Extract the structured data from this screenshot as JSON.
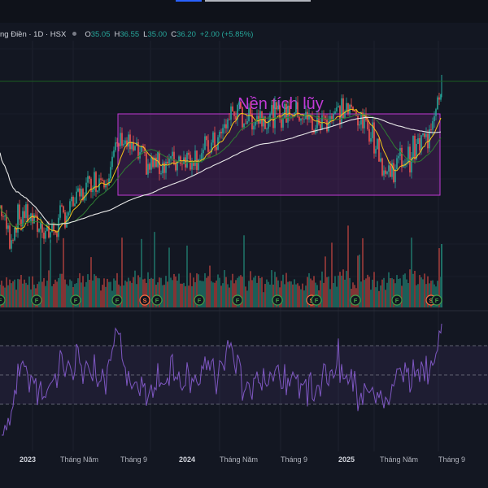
{
  "symbol": {
    "title": "ng Điền · 1D · HSX",
    "open_label": "O",
    "open": "35.05",
    "high_label": "H",
    "high": "36.55",
    "low_label": "L",
    "low": "35.00",
    "close_label": "C",
    "close": "36.20",
    "change": "+2.00 (+5.85%)"
  },
  "annotation": {
    "text": "Nền tích lũy"
  },
  "colors": {
    "up": "#26a69a",
    "down": "#ef5350",
    "box": "#9c27b0",
    "rsi": "#7e57c2",
    "ma_yellow": "#f5c518",
    "ma_white": "#e8e8e8",
    "ma_green": "#2e7d32"
  },
  "x_axis_labels": [
    {
      "text": "2023",
      "year": true
    },
    {
      "text": "Tháng Năm",
      "year": false
    },
    {
      "text": "Tháng 9",
      "year": false
    },
    {
      "text": "2024",
      "year": true
    },
    {
      "text": "Tháng Năm",
      "year": false
    },
    {
      "text": "Tháng 9",
      "year": false
    },
    {
      "text": "2025",
      "year": true
    },
    {
      "text": "Tháng Năm",
      "year": false
    },
    {
      "text": "Tháng 9",
      "year": false
    }
  ],
  "chart_data": [
    {
      "type": "candlestick",
      "title": "ng Điền · 1D · HSX",
      "x": [
        "2023-01",
        "2023-02",
        "2023-03",
        "2023-04",
        "2023-05",
        "2023-06",
        "2023-07",
        "2023-08",
        "2023-09",
        "2023-10",
        "2023-11",
        "2023-12",
        "2024-01",
        "2024-02",
        "2024-03",
        "2024-04",
        "2024-05",
        "2024-06",
        "2024-07",
        "2024-08",
        "2024-09",
        "2024-10",
        "2024-11",
        "2024-12",
        "2025-01",
        "2025-02",
        "2025-03",
        "2025-04",
        "2025-05",
        "2025-06",
        "2025-07",
        "2025-08"
      ],
      "series": [
        {
          "values": [
            15.5,
            19,
            17,
            16,
            18.5,
            21,
            23,
            24,
            29,
            27,
            25,
            25.5,
            26,
            26.5,
            27,
            28.5,
            32.5,
            31.5,
            32,
            31.5,
            32.5,
            32,
            30.5,
            32,
            33,
            32,
            30,
            24,
            25.5,
            27,
            29,
            36.2
          ]
        }
      ],
      "annotations": [
        "Nền tích lũy"
      ],
      "grid": true
    },
    {
      "type": "bar",
      "x": "same as price",
      "grid": false
    },
    {
      "type": "line",
      "x": "same as price",
      "ylim": [
        0,
        100
      ],
      "grid": false
    }
  ]
}
